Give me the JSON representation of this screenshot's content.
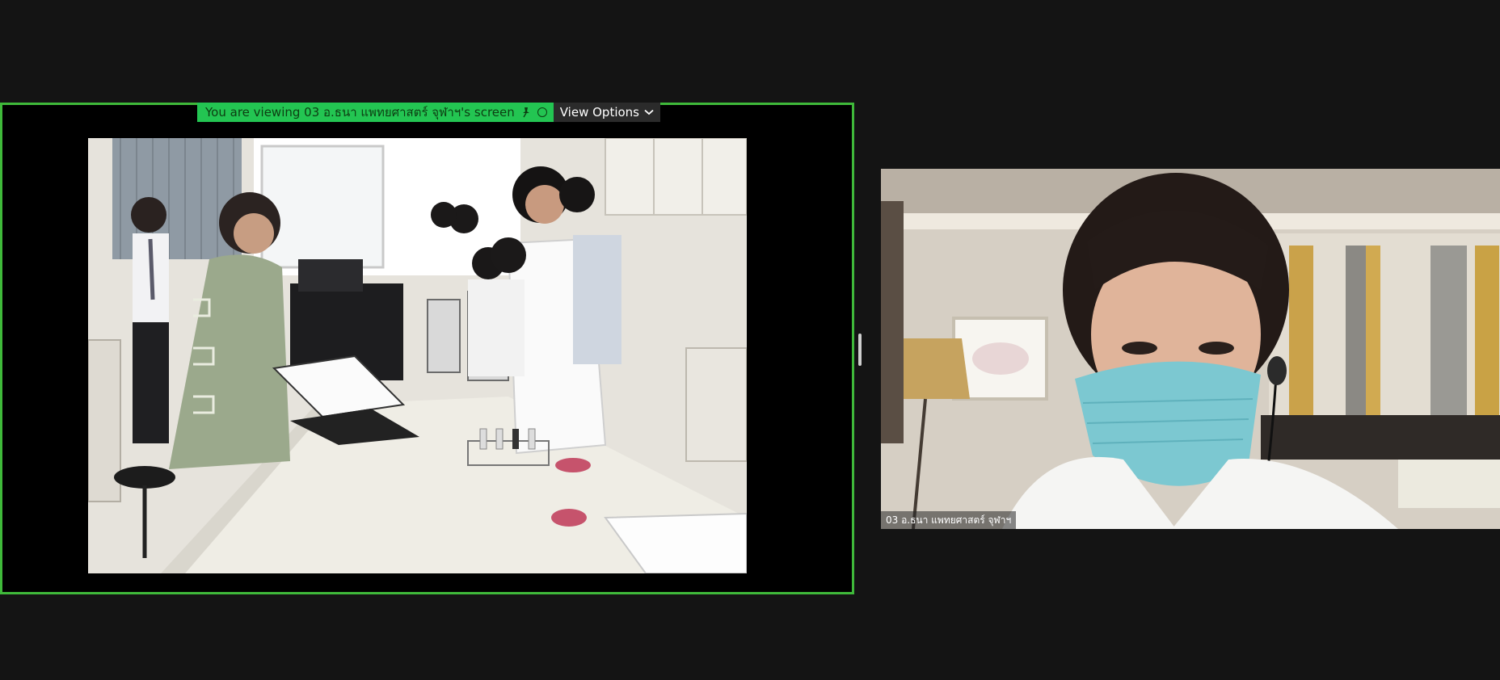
{
  "banner": {
    "message": "You are viewing 03 อ.ธนา แพทยศาสตร์ จุฬาฯ's screen",
    "view_options_label": "View Options"
  },
  "participant": {
    "name": "03 อ.ธนา แพทยศาสตร์ จุฬาฯ"
  },
  "colors": {
    "share_border": "#3fb93a",
    "banner_green": "#23c552",
    "background": "#141414"
  },
  "icons": {
    "pin": "pin-icon",
    "status": "status-circle-icon",
    "chevron": "chevron-down-icon"
  }
}
